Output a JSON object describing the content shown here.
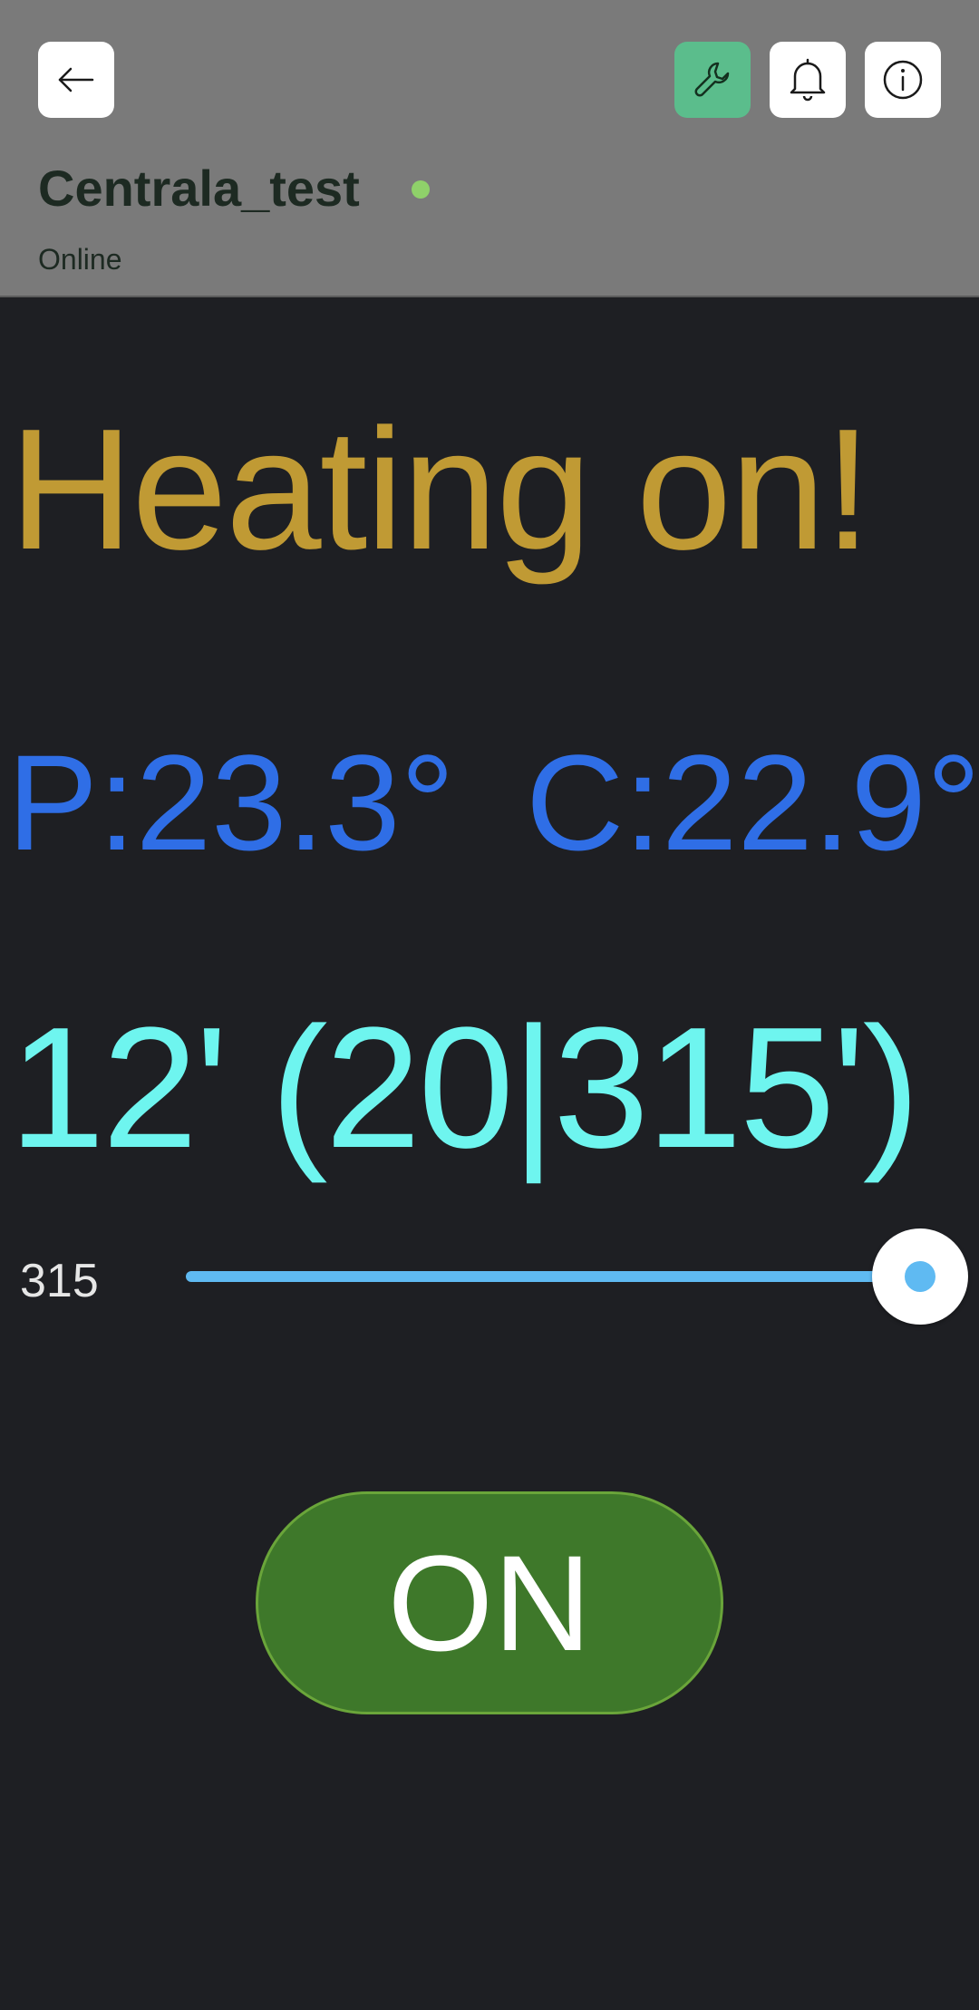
{
  "header": {
    "device_name": "Centrala_test",
    "status": "Online",
    "status_color": "#8fd16a",
    "background": "#7a7a7a",
    "buttons": {
      "back_icon": "arrow-left-icon",
      "tools_icon": "wrench-icon",
      "notifications_icon": "bell-icon",
      "info_icon": "info-icon"
    }
  },
  "main": {
    "heating_message": "Heating on!",
    "temperature_p": "P:23.3°",
    "temperature_c": "C:22.9°",
    "timer_text": "12' (20|315')",
    "slider": {
      "value": "315",
      "fraction": 1.0
    },
    "power_button": {
      "label": "ON",
      "color": "#3e782a"
    }
  },
  "colors": {
    "heating_text": "#c09a34",
    "temperature_text": "#2f6ee6",
    "timer_text": "#6ef5ef",
    "slider_accent": "#5fbaf2",
    "background": "#1e1f23",
    "tools_button": "#5bbd8c"
  }
}
